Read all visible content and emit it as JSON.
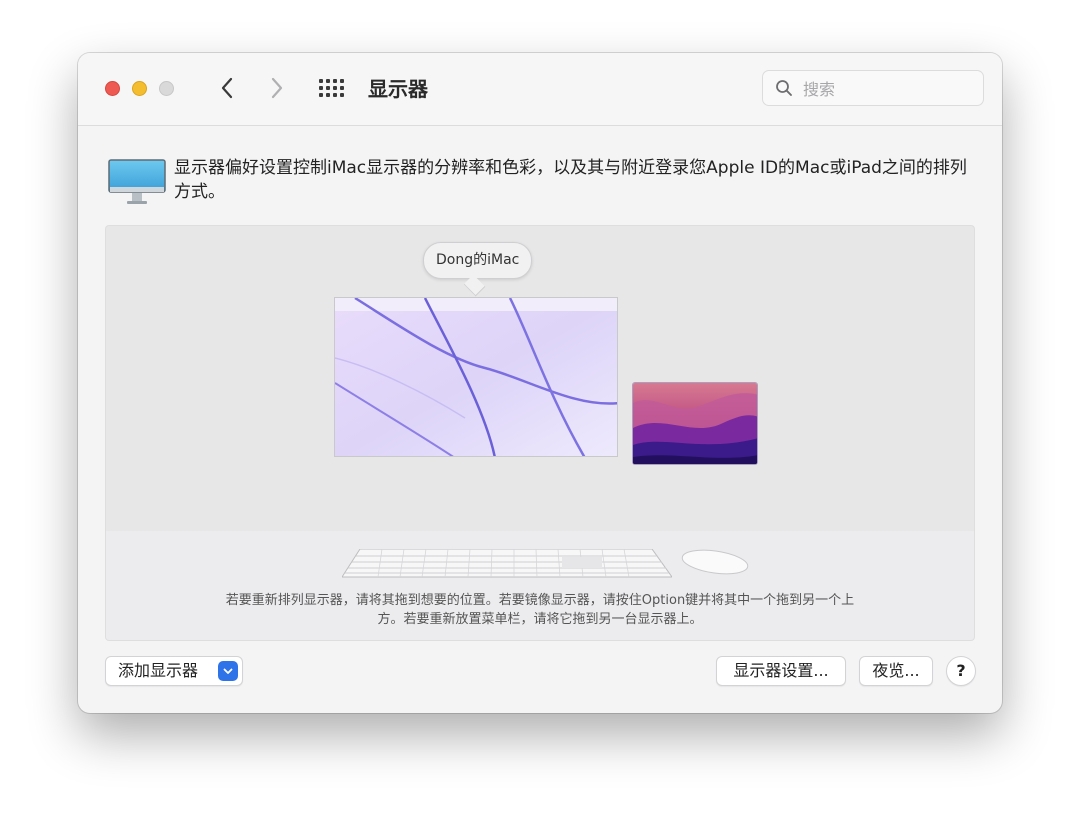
{
  "window": {
    "title": "显示器",
    "search": {
      "placeholder": "搜索",
      "value": ""
    }
  },
  "description": "显示器偏好设置控制iMac显示器的分辨率和色彩，以及其与附近登录您Apple ID的Mac或iPad之间的排列方式。",
  "arrangement": {
    "tooltip": "Dong的iMac",
    "hint_line1": "若要重新排列显示器，请将其拖到想要的位置。若要镜像显示器，请按住Option键并将其中一个拖到另一个上",
    "hint_line2": "方。若要重新放置菜单栏，请将它拖到另一台显示器上。"
  },
  "buttons": {
    "add_display": "添加显示器",
    "display_settings": "显示器设置...",
    "night_shift": "夜览...",
    "help": "?"
  },
  "icons": {
    "back": "chevron-left-icon",
    "forward": "chevron-right-icon",
    "grid": "grid-icon",
    "search": "search-icon",
    "display": "display-icon",
    "dropdown": "chevron-down-icon"
  },
  "colors": {
    "accent": "#2f73e8",
    "close": "#ee5a52",
    "minimize": "#f4bd2f",
    "zoom_disabled": "#d9d9da"
  }
}
